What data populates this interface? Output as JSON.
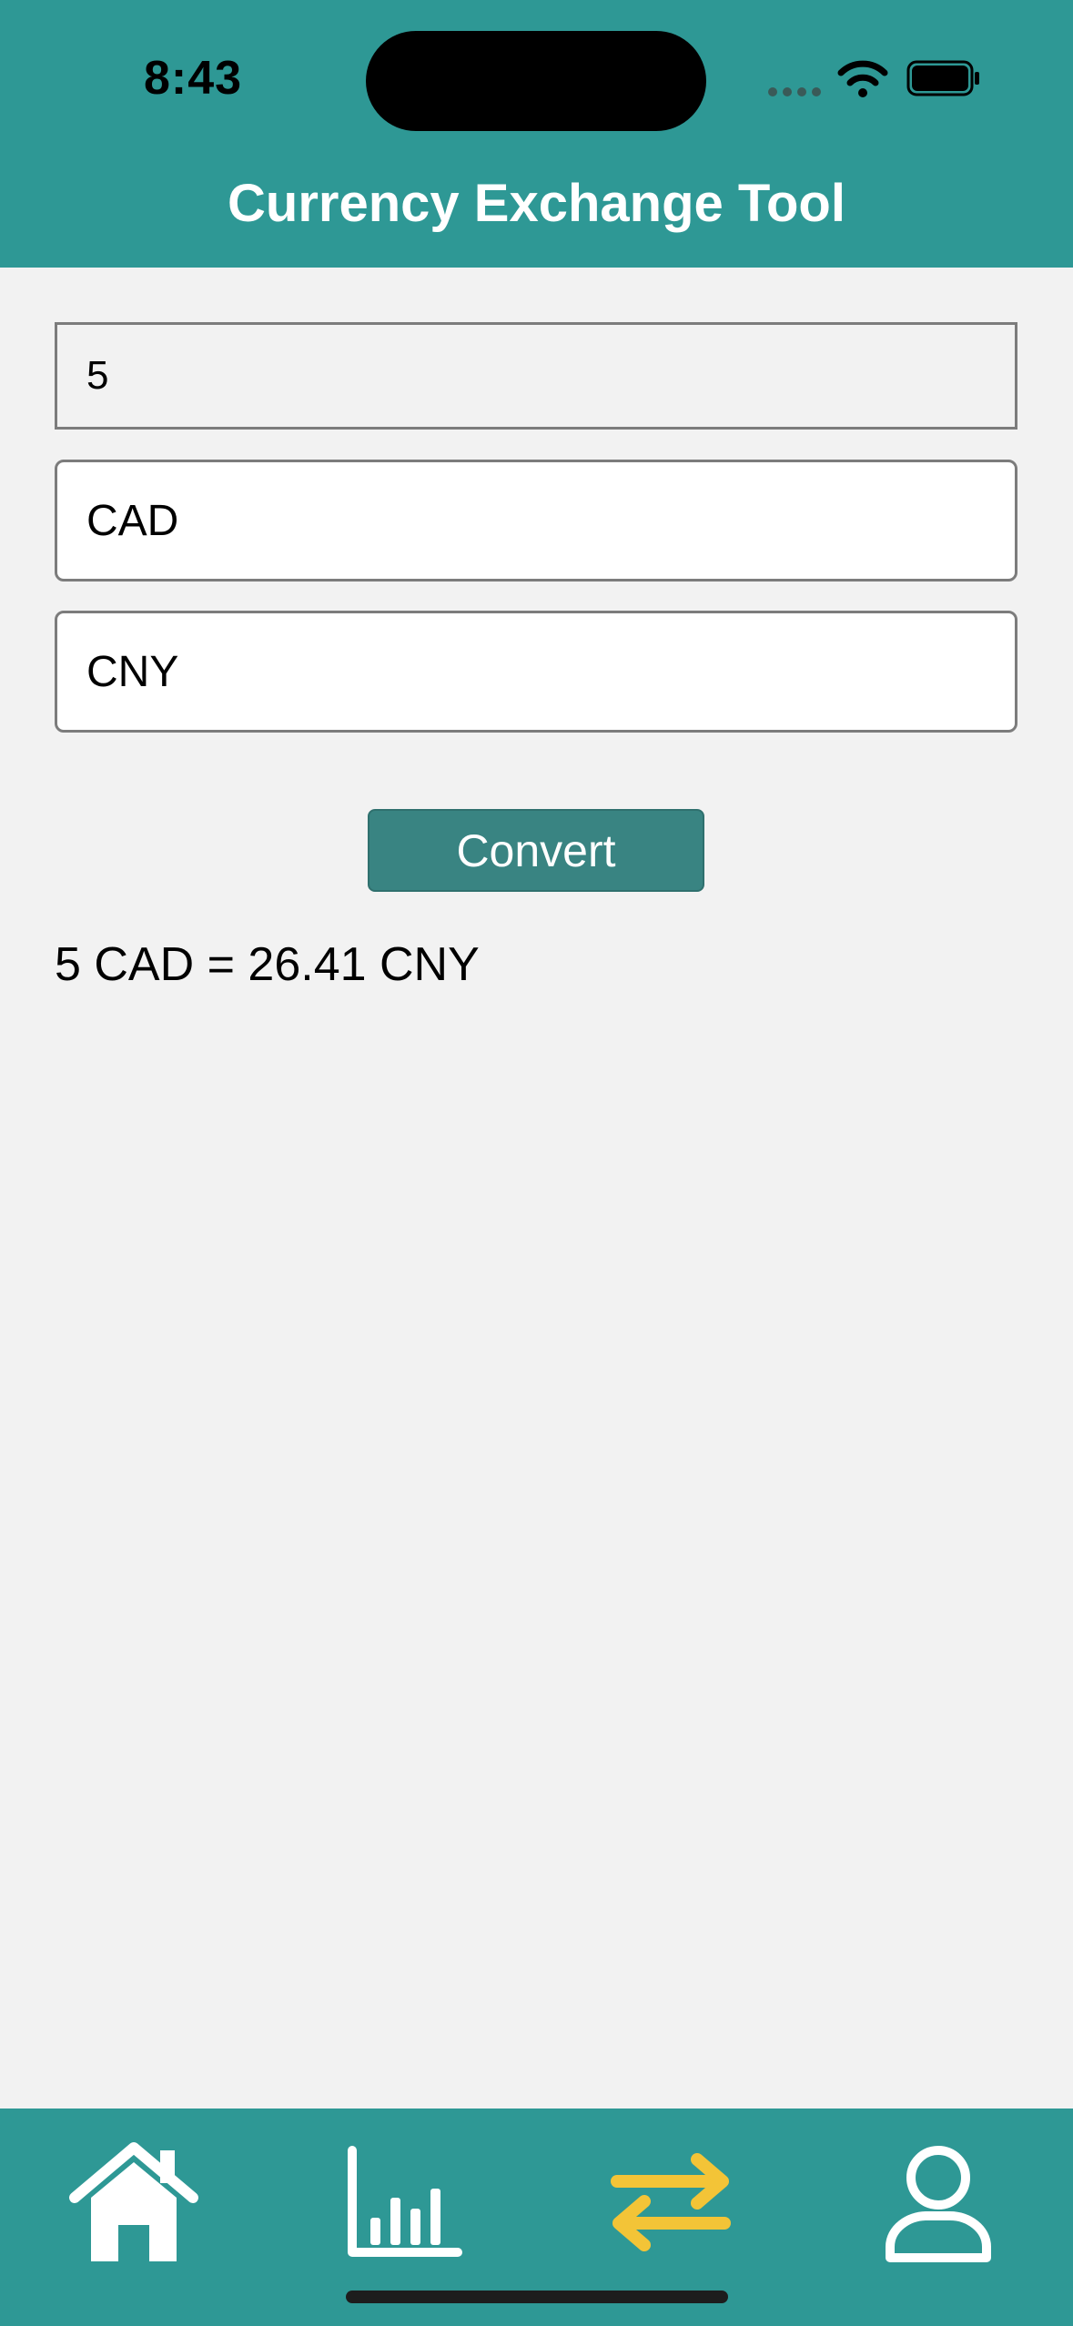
{
  "status_bar": {
    "time": "8:43"
  },
  "header": {
    "title": "Currency Exchange Tool"
  },
  "form": {
    "amount_value": "5",
    "from_currency": "CAD",
    "to_currency": "CNY",
    "convert_label": "Convert"
  },
  "result": {
    "text": "5 CAD = 26.41 CNY"
  },
  "tabbar": {
    "items": [
      {
        "icon": "home-icon",
        "active": false
      },
      {
        "icon": "bar-chart-icon",
        "active": false
      },
      {
        "icon": "exchange-arrows-icon",
        "active": true
      },
      {
        "icon": "user-icon",
        "active": false
      }
    ]
  },
  "colors": {
    "brand_teal": "#2e9895",
    "button_teal": "#398482",
    "active_tab": "#f3c437",
    "inactive_tab": "#ffffff"
  }
}
